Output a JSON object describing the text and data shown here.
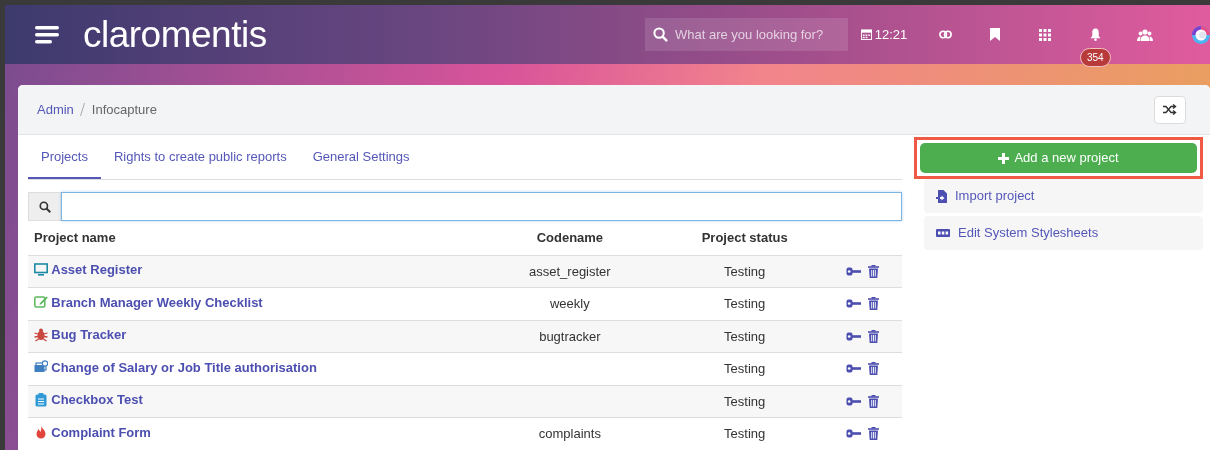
{
  "header": {
    "logo": "claromentis",
    "search": {
      "placeholder": "What are you looking for?"
    },
    "time": "12:21",
    "notifications": "354"
  },
  "breadcrumb": [
    {
      "label": "Admin",
      "link": true
    },
    {
      "label": "Infocapture",
      "link": false
    }
  ],
  "tabs": [
    {
      "label": "Projects",
      "selected": true
    },
    {
      "label": "Rights to create public reports",
      "selected": false
    },
    {
      "label": "General Settings",
      "selected": false
    }
  ],
  "table": {
    "columns": [
      "Project name",
      "Codename",
      "Project status"
    ],
    "rows": [
      {
        "kind": "monitor",
        "color": "#1f8aa6",
        "name": "Asset Register",
        "codename": "asset_register",
        "status": "Testing"
      },
      {
        "kind": "edit",
        "color": "#5cb85c",
        "name": "Branch Manager Weekly Checklist",
        "codename": "weekly",
        "status": "Testing"
      },
      {
        "kind": "bug",
        "color": "#c9473f",
        "name": "Bug Tracker",
        "codename": "bugtracker",
        "status": "Testing"
      },
      {
        "kind": "money",
        "color": "#3f7fc0",
        "name": "Change of Salary or Job Title authorisation",
        "status": "Testing"
      },
      {
        "kind": "clipboard",
        "color": "#2f9ad6",
        "name": "Checkbox Test",
        "status": "Testing"
      },
      {
        "kind": "fire",
        "color": "#e0443a",
        "name": "Complaint Form",
        "codename": "complaints",
        "status": "Testing"
      }
    ]
  },
  "actions": {
    "add_button": {
      "label": "Add a new project",
      "highlighted": true
    },
    "links": [
      {
        "kind": "import",
        "label": "Import project"
      },
      {
        "kind": "css",
        "label": "Edit System Stylesheets"
      }
    ]
  }
}
